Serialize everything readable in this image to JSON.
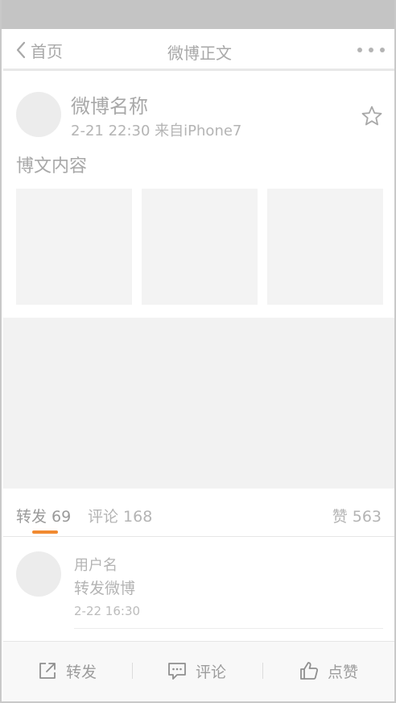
{
  "nav": {
    "back_label": "首页",
    "title": "微博正文",
    "back_icon": "chevron-left-icon",
    "more_icon": "more-dots-icon"
  },
  "post": {
    "author": "微博名称",
    "meta": "2-21 22:30 来自iPhone7",
    "content": "博文内容",
    "image_count": 3,
    "favorite_icon": "star-icon"
  },
  "tabs": {
    "repost": "转发 69",
    "comments": "评论 168",
    "likes": "赞 563"
  },
  "comment": {
    "username": "用户名",
    "text": "转发微博",
    "time": "2-22 16:30"
  },
  "actions": {
    "repost": "转发",
    "comment": "评论",
    "like": "点赞"
  },
  "colors": {
    "accent": "#f18a31",
    "text_gray": "#a8a8a8",
    "placeholder": "#f3f3f3",
    "statusbar": "#c4c4c4"
  }
}
